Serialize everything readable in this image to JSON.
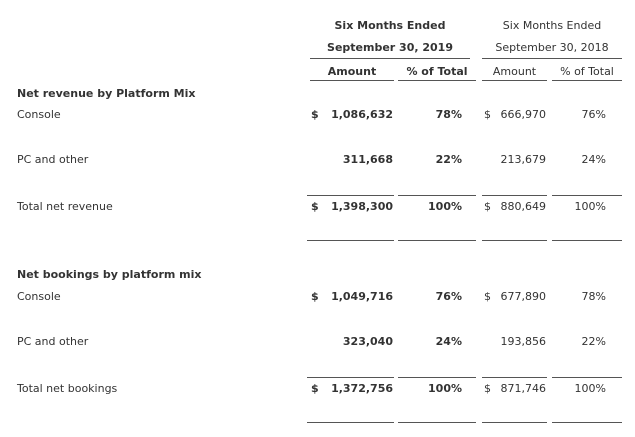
{
  "header": {
    "period_2019": "Six Months Ended",
    "date_2019": "September 30, 2019",
    "period_2018": "Six Months Ended",
    "date_2018": "September 30, 2018",
    "col_amount_2019": "Amount",
    "col_pct_2019": "% of Total",
    "col_amount_2018": "Amount",
    "col_pct_2018": "% of Total"
  },
  "revenue": {
    "section_title": "Net revenue by Platform Mix",
    "rows": [
      {
        "label": "Console",
        "dollar_2019": "$",
        "amount_2019": "1,086,632",
        "pct_2019": "78%",
        "dollar_2018": "$",
        "amount_2018": "666,970",
        "pct_2018": "76%"
      },
      {
        "label": "PC and other",
        "dollar_2019": "",
        "amount_2019": "311,668",
        "pct_2019": "22%",
        "dollar_2018": "",
        "amount_2018": "213,679",
        "pct_2018": "24%"
      },
      {
        "label": "Total net revenue",
        "dollar_2019": "$",
        "amount_2019": "1,398,300",
        "pct_2019": "100%",
        "dollar_2018": "$",
        "amount_2018": "880,649",
        "pct_2018": "100%"
      }
    ]
  },
  "bookings": {
    "section_title": "Net bookings by platform mix",
    "rows": [
      {
        "label": "Console",
        "dollar_2019": "$",
        "amount_2019": "1,049,716",
        "pct_2019": "76%",
        "dollar_2018": "$",
        "amount_2018": "677,890",
        "pct_2018": "78%"
      },
      {
        "label": "PC and other",
        "dollar_2019": "",
        "amount_2019": "323,040",
        "pct_2019": "24%",
        "dollar_2018": "",
        "amount_2018": "193,856",
        "pct_2018": "22%"
      },
      {
        "label": "Total net bookings",
        "dollar_2019": "$",
        "amount_2019": "1,372,756",
        "pct_2019": "100%",
        "dollar_2018": "$",
        "amount_2018": "871,746",
        "pct_2018": "100%"
      }
    ]
  }
}
